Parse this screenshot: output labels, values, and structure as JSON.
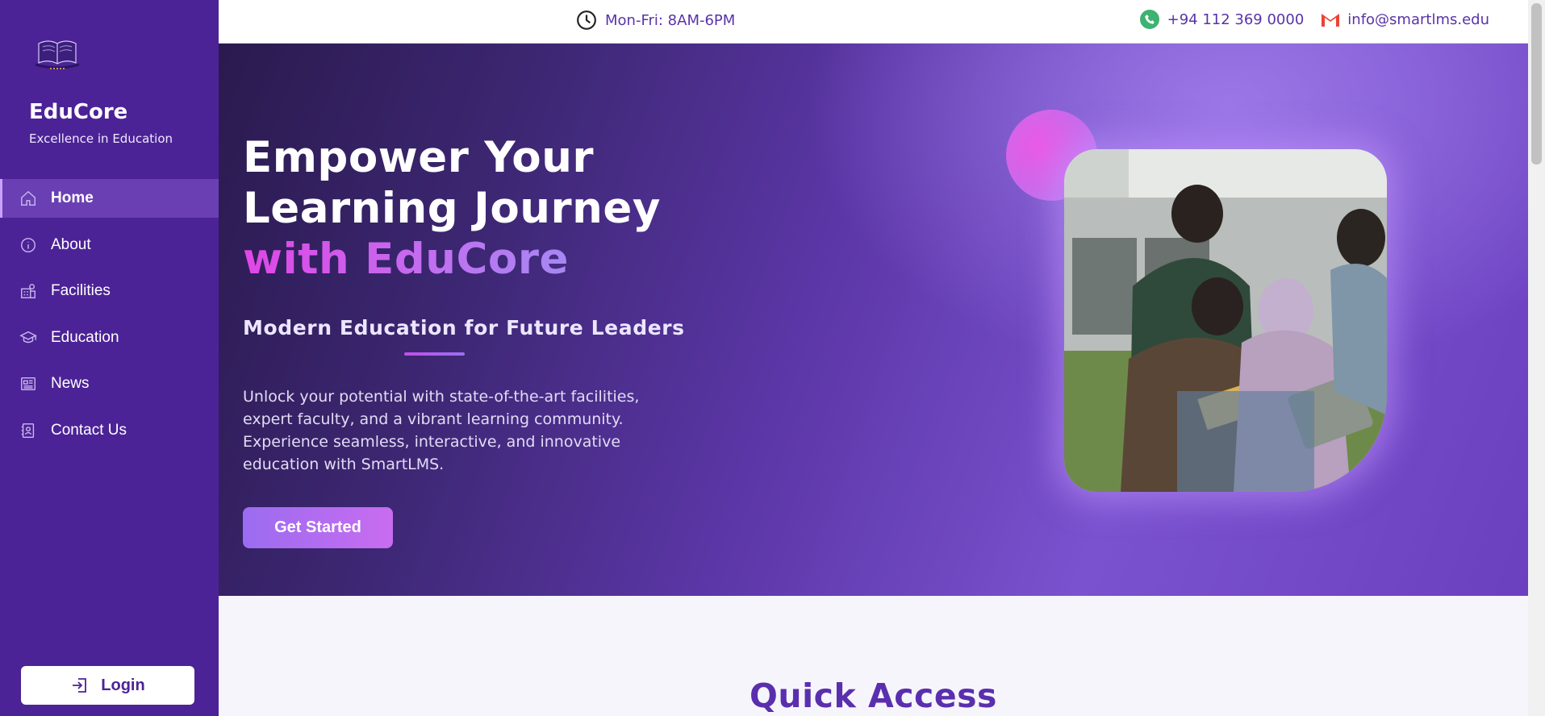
{
  "sidebar": {
    "brand_name": "EduCore",
    "brand_tagline": "Excellence in Education",
    "items": [
      {
        "label": "Home",
        "icon": "home-icon",
        "active": true
      },
      {
        "label": "About",
        "icon": "info-icon",
        "active": false
      },
      {
        "label": "Facilities",
        "icon": "facilities-icon",
        "active": false
      },
      {
        "label": "Education",
        "icon": "graduation-cap-icon",
        "active": false
      },
      {
        "label": "News",
        "icon": "newspaper-icon",
        "active": false
      },
      {
        "label": "Contact Us",
        "icon": "contact-book-icon",
        "active": false
      }
    ],
    "login_label": "Login"
  },
  "topbar": {
    "hours": "Mon-Fri: 8AM-6PM",
    "phone": "+94 112 369 0000",
    "email": "info@smartlms.edu"
  },
  "hero": {
    "title_line1": "Empower Your",
    "title_line2": "Learning Journey",
    "title_accent": "with EduCore",
    "subtitle": "Modern Education for Future Leaders",
    "description": "Unlock your potential with state-of-the-art facilities, expert faculty, and a vibrant learning community. Experience seamless, interactive, and innovative education with SmartLMS.",
    "cta_label": "Get Started"
  },
  "quick_access": {
    "title": "Quick Access"
  },
  "colors": {
    "sidebar_bg": "#4c2396",
    "accent_purple": "#5a2fae",
    "accent_pink": "#e046e6"
  }
}
